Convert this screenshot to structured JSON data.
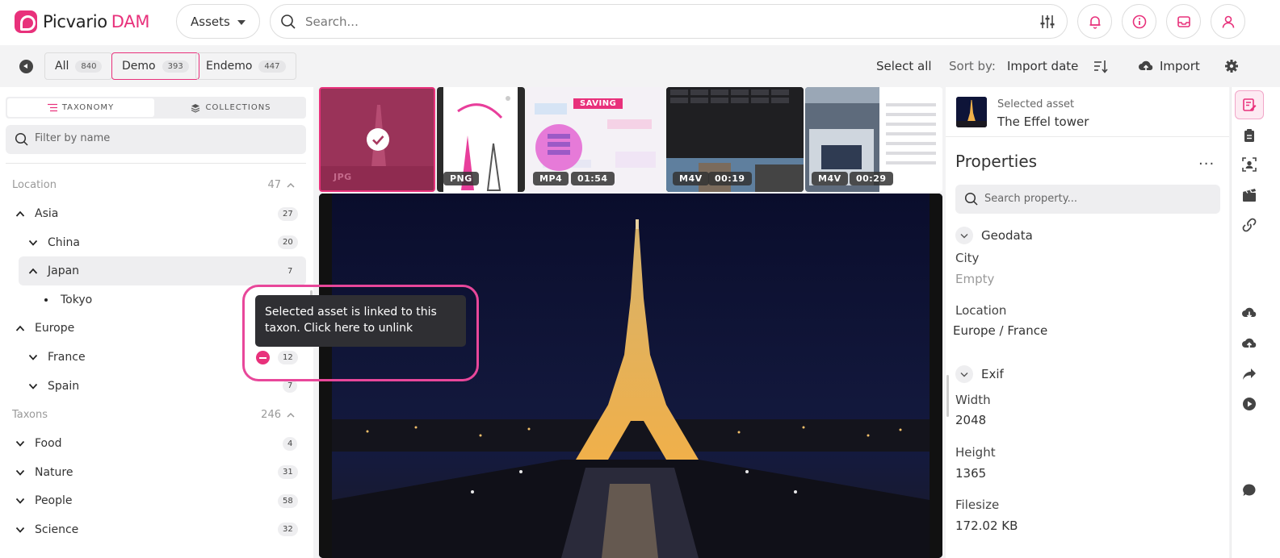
{
  "app": {
    "brand": "Picvario",
    "brand_suffix": "DAM",
    "asset_selector": "Assets",
    "search_placeholder": "Search..."
  },
  "colors": {
    "accent": "#e8317b",
    "ring": "#e8479a",
    "badge_bg": "#eeeef0"
  },
  "header_icons": [
    "filters-icon",
    "bell-icon",
    "info-icon",
    "inbox-icon",
    "user-icon"
  ],
  "toolbar": {
    "chips": [
      {
        "label": "All",
        "count": "840"
      },
      {
        "label": "Demo",
        "count": "393"
      },
      {
        "label": "Endemo",
        "count": "447"
      }
    ],
    "select_all": "Select all",
    "sort_by_label": "Sort by:",
    "sort_value": "Import date",
    "import_label": "Import"
  },
  "left": {
    "tab_taxonomy": "TAXONOMY",
    "tab_collections": "COLLECTIONS",
    "filter_placeholder": "Filter by name",
    "location_title": "Location",
    "location_count": "47",
    "taxons_title": "Taxons",
    "taxons_count": "246",
    "location_items": [
      {
        "label": "Asia",
        "count": "27"
      },
      {
        "label": "China",
        "count": "20"
      },
      {
        "label": "Japan",
        "count": "7"
      },
      {
        "label": "Tokyo",
        "count": ""
      },
      {
        "label": "Europe",
        "count": ""
      },
      {
        "label": "France",
        "count": "12"
      },
      {
        "label": "Spain",
        "count": "7"
      }
    ],
    "taxon_items": [
      {
        "label": "Food",
        "count": "4"
      },
      {
        "label": "Nature",
        "count": "31"
      },
      {
        "label": "People",
        "count": "58"
      },
      {
        "label": "Science",
        "count": "32"
      }
    ],
    "tooltip": "Selected asset is linked to this taxon. Click here to unlink"
  },
  "thumbs": [
    {
      "type": "JPG",
      "duration": ""
    },
    {
      "type": "PNG",
      "duration": ""
    },
    {
      "type": "MP4",
      "duration": "01:54",
      "status": "SAVING"
    },
    {
      "type": "M4V",
      "duration": "00:19"
    },
    {
      "type": "M4V",
      "duration": "00:29"
    }
  ],
  "right": {
    "selected_label": "Selected asset",
    "selected_name": "The Effel tower",
    "properties_title": "Properties",
    "more": "...",
    "search_placeholder": "Search property...",
    "group_geodata": "Geodata",
    "city_label": "City",
    "city_value": "Empty",
    "location_label": "Location",
    "location_value": "Europe / France",
    "group_exif": "Exif",
    "width_label": "Width",
    "width_value": "2048",
    "height_label": "Height",
    "height_value": "1365",
    "filesize_label": "Filesize",
    "filesize_value": "172.02 KB"
  },
  "rail_icons": [
    "edit-properties-icon",
    "clipboard-icon",
    "face-scan-icon",
    "video-clip-icon",
    "link-icon",
    "cloud-download-icon",
    "cloud-upload-icon",
    "share-icon",
    "play-icon",
    "chat-icon"
  ]
}
